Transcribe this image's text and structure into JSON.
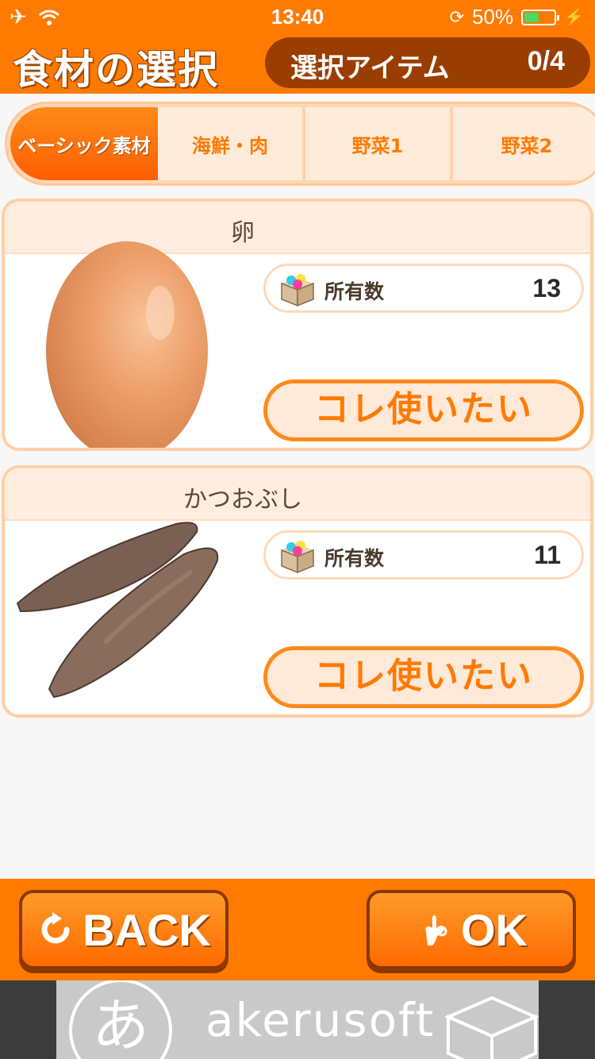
{
  "status_bar": {
    "time": "13:40",
    "battery": "50%"
  },
  "header": {
    "title": "食材の選択",
    "selected_label": "選択アイテム",
    "selected_count": "0/4"
  },
  "tabs": [
    {
      "label": "ベーシック素材",
      "active": true
    },
    {
      "label": "海鮮・肉",
      "active": false
    },
    {
      "label": "野菜1",
      "active": false
    },
    {
      "label": "野菜2",
      "active": false
    }
  ],
  "items": [
    {
      "name": "卵",
      "owned_label": "所有数",
      "owned_count": "13",
      "use_button": "コレ使いたい",
      "image_icon": "egg-image"
    },
    {
      "name": "かつおぶし",
      "owned_label": "所有数",
      "owned_count": "11",
      "use_button": "コレ使いたい",
      "image_icon": "katsuobushi-image"
    }
  ],
  "bottom_bar": {
    "back_label": "BACK",
    "ok_label": "OK"
  },
  "ad": {
    "brand": "akerusoft",
    "logo_char": "あ"
  },
  "colors": {
    "accent": "#ff7a00",
    "accent_dark": "#9a3d00",
    "card_border": "#ffcfa5"
  }
}
